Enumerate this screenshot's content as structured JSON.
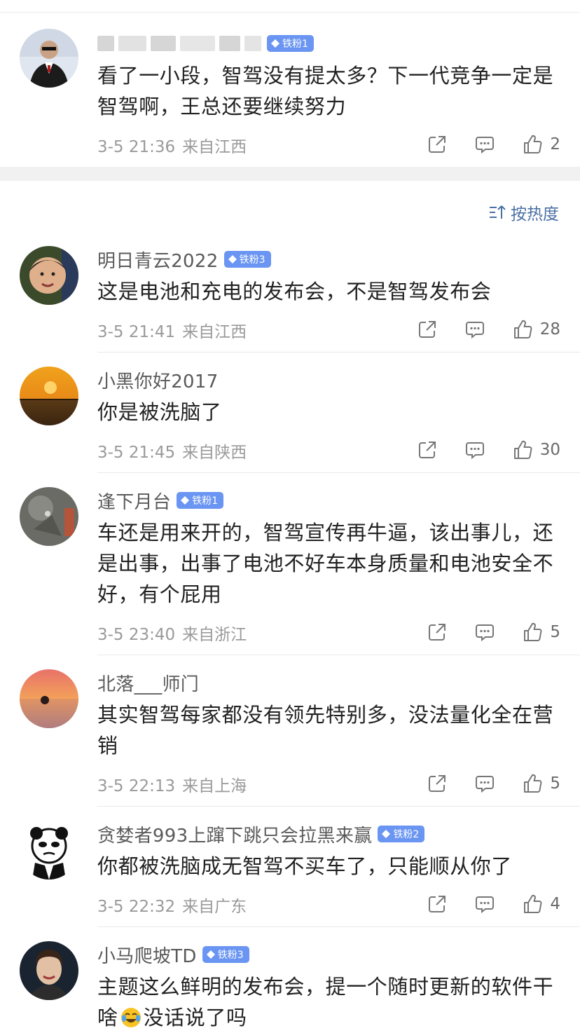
{
  "comments_top": [
    {
      "name": "",
      "badge": "铁粉1",
      "text": "看了一小段，智驾没有提太多？下一代竞争一定是智驾啊，王总还要继续努力",
      "date": "3-5 21:36",
      "location": "来自江西",
      "likes": "2"
    }
  ],
  "sort": {
    "label": "按热度"
  },
  "comments": [
    {
      "name": "明日青云2022",
      "badge": "铁粉3",
      "text": "这是电池和充电的发布会，不是智驾发布会",
      "date": "3-5 21:41",
      "location": "来自江西",
      "likes": "28"
    },
    {
      "name": "小黑你好2017",
      "badge": "",
      "text": "你是被洗脑了",
      "date": "3-5 21:45",
      "location": "来自陕西",
      "likes": "30"
    },
    {
      "name": "逢下月台",
      "badge": "铁粉1",
      "text": "车还是用来开的，智驾宣传再牛逼，该出事儿，还是出事，出事了电池不好车本身质量和电池安全不好，有个屁用",
      "date": "3-5 23:40",
      "location": "来自浙江",
      "likes": "5"
    },
    {
      "name": "北落___师门",
      "badge": "",
      "text": "其实智驾每家都没有领先特别多，没法量化全在营销",
      "date": "3-5 22:13",
      "location": "来自上海",
      "likes": "5"
    },
    {
      "name": "贪婪者993上蹿下跳只会拉黑来赢",
      "badge": "铁粉2",
      "text": "你都被洗脑成无智驾不买车了，只能顺从你了",
      "date": "3-5 22:32",
      "location": "来自广东",
      "likes": "4"
    },
    {
      "name": "小马爬坡TD",
      "badge": "铁粉3",
      "text_a": "主题这么鲜明的发布会，提一个随时更新的软件干啥",
      "text_b": "没话说了吗",
      "date": "",
      "location": "",
      "likes": ""
    }
  ],
  "colors": {
    "badge": "#6a95f2",
    "sort": "#4a6fa5",
    "meta": "#9a9a9a"
  }
}
